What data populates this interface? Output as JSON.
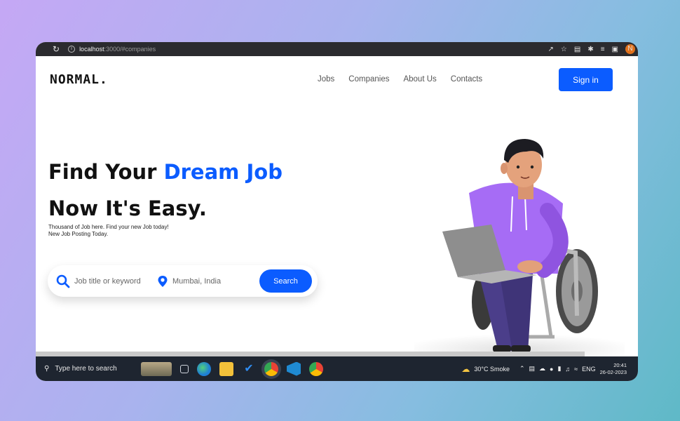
{
  "browser": {
    "url_host": "localhost",
    "url_path": ":3000/#companies",
    "profile_initial": "N"
  },
  "header": {
    "logo": "NORMAL.",
    "nav": [
      "Jobs",
      "Companies",
      "About Us",
      "Contacts"
    ],
    "sign_in_label": "Sign in"
  },
  "hero": {
    "title_prefix": "Find Your ",
    "title_accent": "Dream Job",
    "title_line2": "Now It's Easy.",
    "subtitle": "Thousand of Job here. Find your new Job today! New Job Posting Today."
  },
  "search": {
    "keyword_placeholder": "Job title or keyword",
    "location_value": "Mumbai, India",
    "button_label": "Search"
  },
  "taskbar": {
    "search_placeholder": "Type here to search",
    "weather": "30°C  Smoke",
    "language": "ENG",
    "time": "20:41",
    "date": "26-02-2023"
  },
  "colors": {
    "accent": "#0b5cff",
    "hoodie": "#a66cf5",
    "pants": "#4b3e8a"
  }
}
